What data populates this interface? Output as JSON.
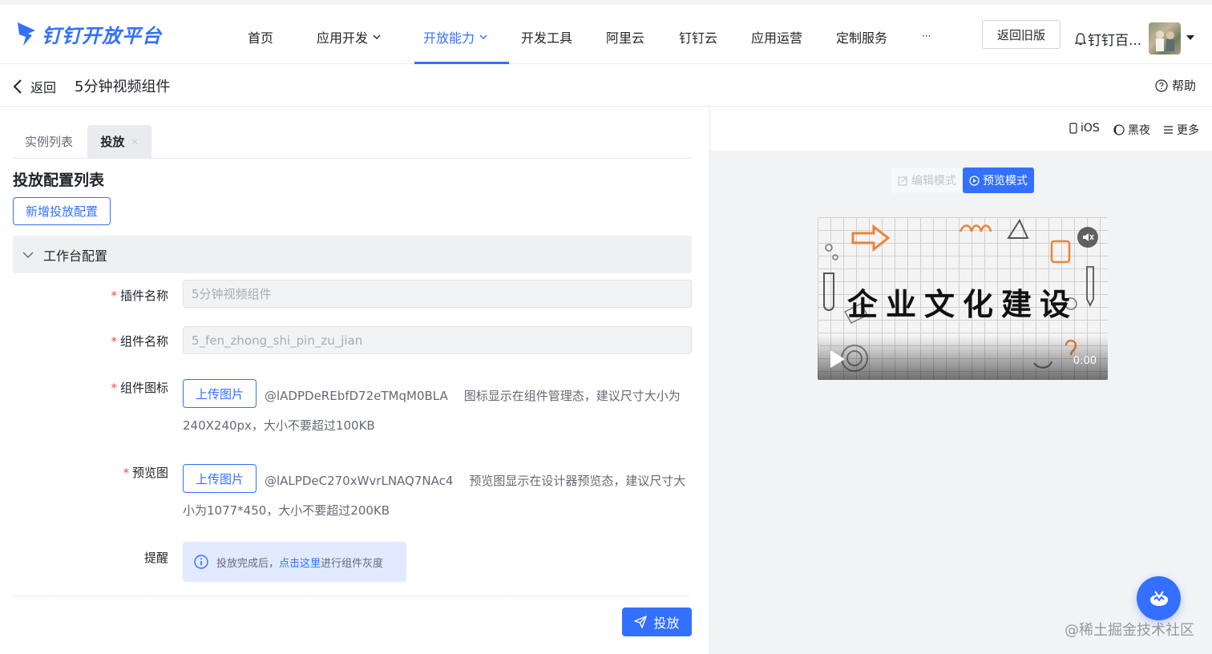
{
  "brand": {
    "name": "钉钉开放平台",
    "color": "#3370ff"
  },
  "nav": {
    "items": [
      {
        "label": "首页",
        "has_dropdown": false,
        "active": false
      },
      {
        "label": "应用开发",
        "has_dropdown": true,
        "active": false
      },
      {
        "label": "开放能力",
        "has_dropdown": true,
        "active": true
      },
      {
        "label": "开发工具",
        "has_dropdown": false,
        "active": false
      },
      {
        "label": "阿里云",
        "has_dropdown": false,
        "active": false
      },
      {
        "label": "钉钉云",
        "has_dropdown": false,
        "active": false
      },
      {
        "label": "应用运营",
        "has_dropdown": false,
        "active": false
      },
      {
        "label": "定制服务",
        "has_dropdown": false,
        "active": false
      },
      {
        "label": "···",
        "has_dropdown": false,
        "active": false
      }
    ],
    "old_version_label": "返回旧版",
    "org_name": "钉钉百...",
    "avatar_icon": "user-avatar-photo"
  },
  "subheader": {
    "back_label": "返回",
    "title": "5分钟视频组件",
    "help_label": "帮助"
  },
  "tabs": [
    {
      "label": "实例列表",
      "active": false
    },
    {
      "label": "投放",
      "active": true,
      "close": "×"
    }
  ],
  "config": {
    "section_title": "投放配置列表",
    "add_button": "新增投放配置",
    "panel_title": "工作台配置",
    "fields": {
      "plugin_name": {
        "label": "插件名称",
        "required": true,
        "value": "5分钟视频组件"
      },
      "component_name": {
        "label": "组件名称",
        "required": true,
        "value": "5_fen_zhong_shi_pin_zu_jian"
      },
      "component_icon": {
        "label": "组件图标",
        "required": true,
        "button": "上传图片",
        "file_id": "@lADPDeREbfD72eTMqM0BLA",
        "hint_part1": "图标显示在组件管理态，建议尺寸大小为",
        "hint_part2": "240X240px，大小不要超过100KB"
      },
      "preview_image": {
        "label": "预览图",
        "required": true,
        "button": "上传图片",
        "file_id": "@lALPDeC270xWvrLNAQ7NAc4",
        "hint_part1": "预览图显示在设计器预览态，建议尺寸大",
        "hint_part2": "小为1077*450，大小不要超过200KB"
      },
      "reminder": {
        "label": "提醒",
        "text_before": "投放完成后，",
        "link": "点击这里",
        "text_after": "进行组件灰度"
      }
    },
    "deploy_button": "投放"
  },
  "preview": {
    "toolbar": [
      {
        "icon": "phone-icon",
        "label": "iOS"
      },
      {
        "icon": "moon-icon",
        "label": "黑夜"
      },
      {
        "icon": "menu-icon",
        "label": "更多"
      }
    ],
    "mode_edit": "编辑模式",
    "mode_preview": "预览模式",
    "active_mode": "预览模式",
    "video": {
      "title": "企业文化建设",
      "time": "0:00",
      "muted": true
    }
  },
  "watermark": "@稀土掘金技术社区"
}
